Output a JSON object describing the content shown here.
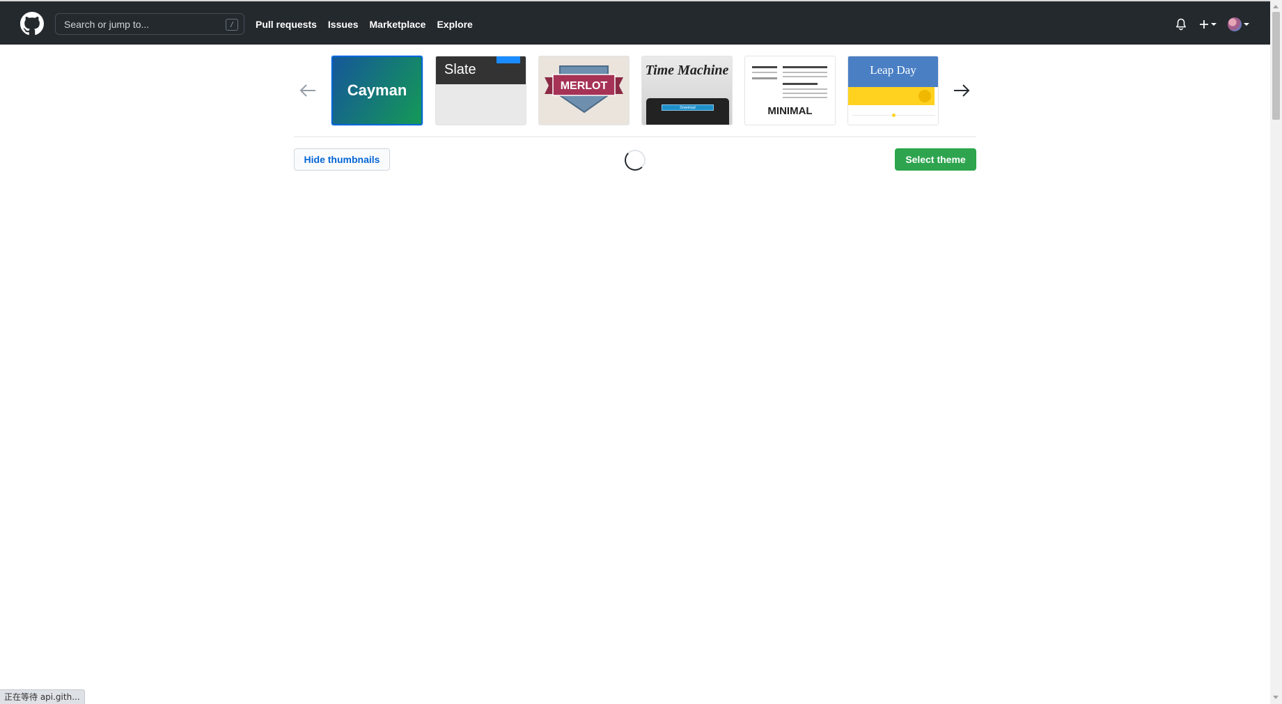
{
  "header": {
    "logo_icon": "github-mark-icon",
    "search": {
      "placeholder": "Search or jump to...",
      "shortcut": "/"
    },
    "nav": [
      "Pull requests",
      "Issues",
      "Marketplace",
      "Explore"
    ],
    "right_icons": [
      "bell-icon",
      "plus-icon",
      "avatar"
    ]
  },
  "theme_chooser": {
    "prev_icon": "arrow-left-icon",
    "next_icon": "arrow-right-icon",
    "selected": "Cayman",
    "themes": [
      {
        "name": "Cayman",
        "label": "Cayman"
      },
      {
        "name": "Slate",
        "label": "Slate"
      },
      {
        "name": "Merlot",
        "label": "MERLOT"
      },
      {
        "name": "Time Machine",
        "label": "Time Machine",
        "button_text": "Download"
      },
      {
        "name": "Minimal",
        "label": "MINIMAL"
      },
      {
        "name": "Leap Day",
        "label": "Leap Day"
      }
    ],
    "hide_thumbnails_label": "Hide thumbnails",
    "select_theme_label": "Select theme"
  },
  "status_bar": {
    "text": "正在等待 api.gith..."
  },
  "colors": {
    "header_bg": "#24292e",
    "primary_green": "#2ea44f",
    "link_blue": "#0366d6"
  }
}
